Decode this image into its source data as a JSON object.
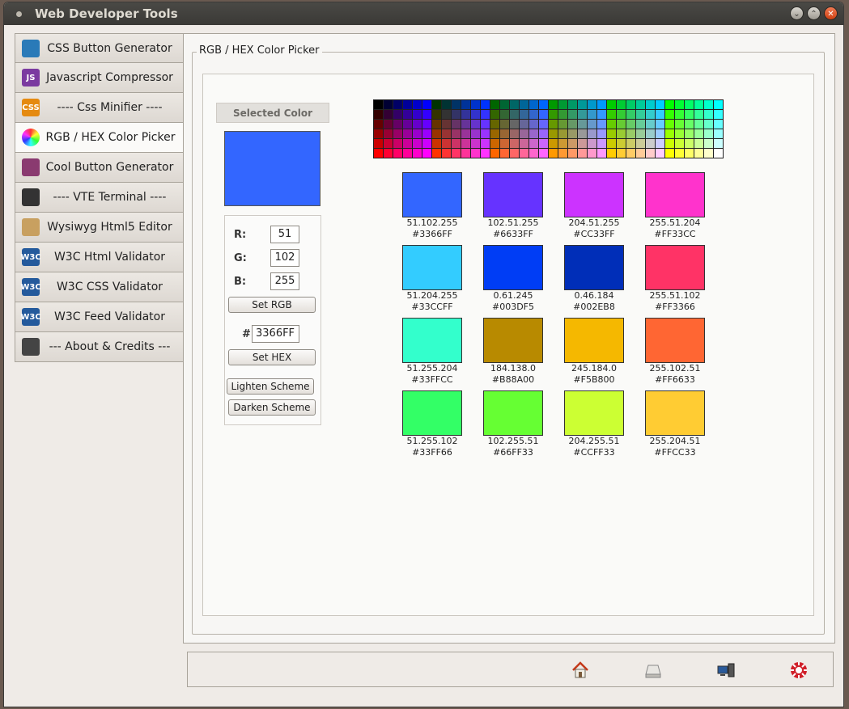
{
  "window": {
    "title": "Web Developer Tools"
  },
  "sidebar": {
    "items": [
      {
        "label": "CSS Button Generator",
        "icon": "css-button-icon",
        "color": "#2a7ab8"
      },
      {
        "label": "Javascript Compressor",
        "icon": "javascript-icon",
        "color": "#7b3aa0",
        "glyph": "JS"
      },
      {
        "label": "---- Css Minifier ----",
        "icon": "css-minifier-icon",
        "color": "#e58a10",
        "glyph": "CSS"
      },
      {
        "label": "RGB / HEX Color Picker",
        "icon": "color-wheel-icon",
        "color": "#d04060"
      },
      {
        "label": "Cool Button Generator",
        "icon": "cool-button-icon",
        "color": "#8a3a70"
      },
      {
        "label": "---- VTE Terminal ----",
        "icon": "terminal-icon",
        "color": "#333333"
      },
      {
        "label": "Wysiwyg Html5 Editor",
        "icon": "editor-icon",
        "color": "#c8a060"
      },
      {
        "label": "W3C Html Validator",
        "icon": "w3c-icon",
        "color": "#245a9c",
        "glyph": "W3C"
      },
      {
        "label": "W3C CSS Validator",
        "icon": "w3c-icon",
        "color": "#245a9c",
        "glyph": "W3C"
      },
      {
        "label": "W3C Feed Validator",
        "icon": "w3c-icon",
        "color": "#245a9c",
        "glyph": "W3C"
      },
      {
        "label": "--- About & Credits ---",
        "icon": "person-icon",
        "color": "#444444"
      }
    ],
    "active_index": 3
  },
  "picker": {
    "group_title": "RGB / HEX Color Picker",
    "selected_label": "Selected Color",
    "selected_color": "#3366FF",
    "r_label": "R:",
    "g_label": "G:",
    "b_label": "B:",
    "r": "51",
    "g": "102",
    "b": "255",
    "set_rgb": "Set RGB",
    "hash": "#",
    "hex": "3366FF",
    "set_hex": "Set HEX",
    "lighten": "Lighten Scheme",
    "darken": "Darken Scheme"
  },
  "swatches": [
    {
      "rgb": "51.102.255",
      "hex": "#3366FF",
      "color": "#3366FF"
    },
    {
      "rgb": "102.51.255",
      "hex": "#6633FF",
      "color": "#6633FF"
    },
    {
      "rgb": "204.51.255",
      "hex": "#CC33FF",
      "color": "#CC33FF"
    },
    {
      "rgb": "255.51.204",
      "hex": "#FF33CC",
      "color": "#FF33CC"
    },
    {
      "rgb": "51.204.255",
      "hex": "#33CCFF",
      "color": "#33CCFF"
    },
    {
      "rgb": "0.61.245",
      "hex": "#003DF5",
      "color": "#003DF5"
    },
    {
      "rgb": "0.46.184",
      "hex": "#002EB8",
      "color": "#002EB8"
    },
    {
      "rgb": "255.51.102",
      "hex": "#FF3366",
      "color": "#FF3366"
    },
    {
      "rgb": "51.255.204",
      "hex": "#33FFCC",
      "color": "#33FFCC"
    },
    {
      "rgb": "184.138.0",
      "hex": "#B88A00",
      "color": "#B88A00"
    },
    {
      "rgb": "245.184.0",
      "hex": "#F5B800",
      "color": "#F5B800"
    },
    {
      "rgb": "255.102.51",
      "hex": "#FF6633",
      "color": "#FF6633"
    },
    {
      "rgb": "51.255.102",
      "hex": "#33FF66",
      "color": "#33FF66"
    },
    {
      "rgb": "102.255.51",
      "hex": "#66FF33",
      "color": "#66FF33"
    },
    {
      "rgb": "204.255.51",
      "hex": "#CCFF33",
      "color": "#CCFF33"
    },
    {
      "rgb": "255.204.51",
      "hex": "#FFCC33",
      "color": "#FFCC33"
    }
  ],
  "bottombar": {
    "icons": [
      "home-icon",
      "drive-icon",
      "network-icon",
      "help-lifebuoy-icon"
    ]
  }
}
